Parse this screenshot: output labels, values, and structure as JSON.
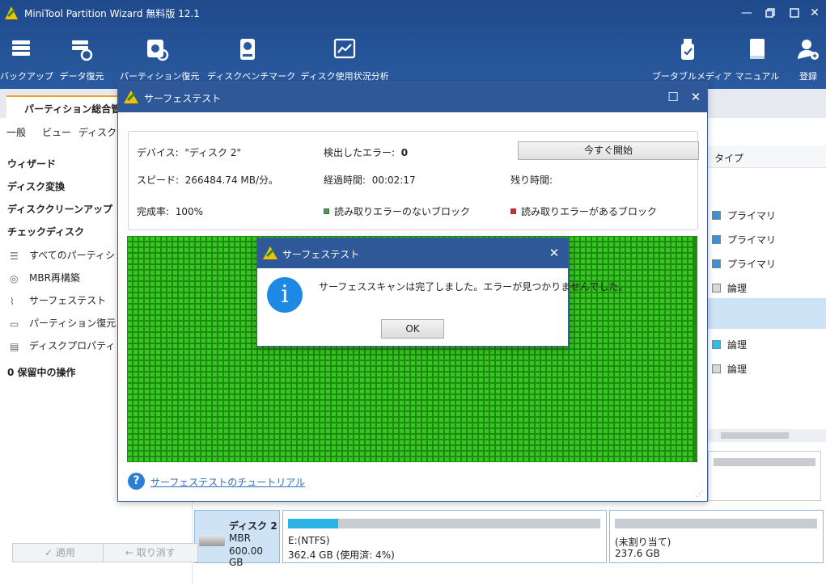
{
  "app": {
    "title": "MiniTool Partition Wizard 無料版 12.1",
    "minimize": "—",
    "restore": "❐",
    "close": "✕"
  },
  "toolbar": {
    "backup": "バックアップ",
    "data_recovery": "データ復元",
    "partition_recovery": "パーティション復元",
    "disk_benchmark": "ディスクベンチマーク",
    "space_analyzer": "ディスク使用状況分析",
    "bootable_media": "ブータブルメディア",
    "manual": "マニュアル",
    "register": "登録"
  },
  "tabs": {
    "main": "パーティション総合管理"
  },
  "menu": {
    "general": "一般",
    "view": "ビュー",
    "disk": "ディスク"
  },
  "left_panel": {
    "wizard": "ウィザード",
    "disk_convert": "ディスク変換",
    "disk_cleanup": "ディスククリーンアップ",
    "check_disk": "チェックディスク",
    "items": {
      "align_all": "すべてのパーティションを",
      "rebuild_mbr": "MBR再構築",
      "surface_test": "サーフェステスト",
      "partition_recovery": "パーティション復元",
      "disk_properties": "ディスクプロパティ"
    },
    "pending": "0 保留中の操作",
    "apply": "適用",
    "undo": "取り消す"
  },
  "partition_list": {
    "type_header": "タイプ",
    "rows": [
      "プライマリ",
      "プライマリ",
      "プライマリ",
      "論理",
      "論理",
      "論理"
    ]
  },
  "disk_map": {
    "disk_name": "ディスク 2",
    "disk_style": "MBR",
    "disk_size": "600.00 GB",
    "part1_label": "E:(NTFS)",
    "part1_info": "362.4 GB (使用済: 4%)",
    "part1_used_percent": 4,
    "part2_label": "(未割り当て)",
    "part2_info": "237.6 GB"
  },
  "surface_dialog": {
    "title": "サーフェステスト",
    "maximize": "☐",
    "close": "✕",
    "device_label": "デバイス:",
    "device_value": "\"ディスク 2\"",
    "errors_label": "検出したエラー:",
    "errors_value": "0",
    "start_button": "今すぐ開始",
    "speed_label": "スピード:",
    "speed_value": "266484.74 MB/分。",
    "elapsed_label": "経過時間:",
    "elapsed_value": "00:02:17",
    "remaining_label": "残り時間:",
    "remaining_value": "",
    "completion_label": "完成率:",
    "completion_value": "100%",
    "legend_ok": "読み取りエラーのないブロック",
    "legend_bad": "読み取りエラーがあるブロック",
    "legend_ok_color": "#2fb52a",
    "legend_bad_color": "#d42a2a",
    "tutorial_link": "サーフェステストのチュートリアル"
  },
  "message_box": {
    "title": "サーフェステスト",
    "close": "✕",
    "icon_glyph": "i",
    "text": "サーフェススキャンは完了しました。エラーが見つかりませんでした。",
    "ok": "OK"
  }
}
